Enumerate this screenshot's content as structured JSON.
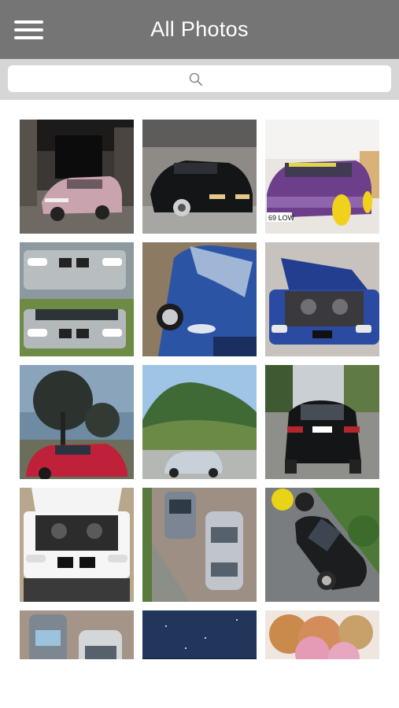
{
  "header": {
    "title": "All Photos",
    "menu_icon": "hamburger-menu-icon"
  },
  "search": {
    "placeholder": "",
    "icon": "search-icon"
  },
  "colors": {
    "header_bg": "#757575",
    "search_bar_bg": "#d6d6d6"
  },
  "photos": [
    {
      "id": "photo-1",
      "subject": "pink car in abandoned garage"
    },
    {
      "id": "photo-2",
      "subject": "black car in dim room"
    },
    {
      "id": "photo-3",
      "subject": "purple car with yellow wheels"
    },
    {
      "id": "photo-4",
      "subject": "silver car front views"
    },
    {
      "id": "photo-5",
      "subject": "blue car close-up"
    },
    {
      "id": "photo-6",
      "subject": "blue car with open hood"
    },
    {
      "id": "photo-7",
      "subject": "red car under tree"
    },
    {
      "id": "photo-8",
      "subject": "silver car in valley"
    },
    {
      "id": "photo-9",
      "subject": "black car rear view"
    },
    {
      "id": "photo-10",
      "subject": "white car engine bay"
    },
    {
      "id": "photo-11",
      "subject": "two cars aerial view"
    },
    {
      "id": "photo-12",
      "subject": "black car with motorcycles"
    },
    {
      "id": "photo-13",
      "subject": "two cars aerial view"
    },
    {
      "id": "photo-14",
      "subject": "night sky"
    },
    {
      "id": "photo-15",
      "subject": "pink trees"
    }
  ]
}
